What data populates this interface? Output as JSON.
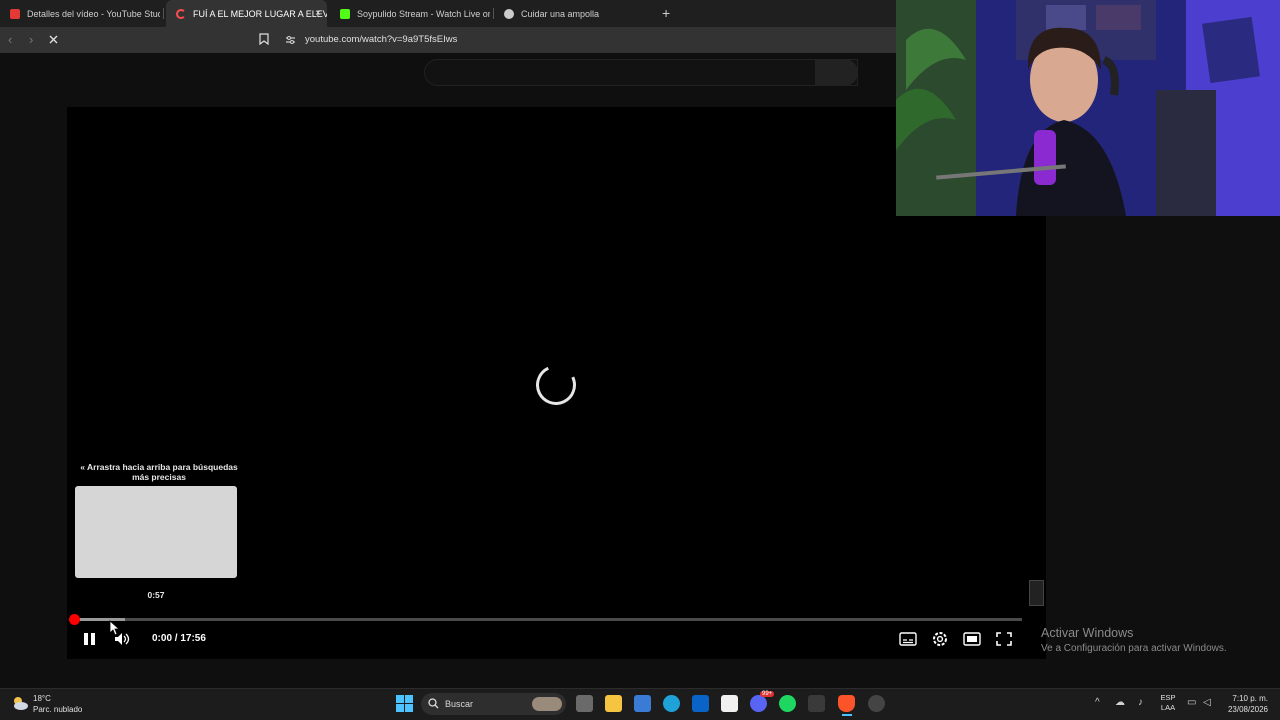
{
  "browser": {
    "tabs": [
      {
        "title": "Detalles del vídeo - YouTube Studio",
        "color": "#e53935"
      },
      {
        "title": "FUÍ A EL MEJOR LUGAR A ELEVA",
        "color": "#ff4d4d"
      },
      {
        "title": "Soypulido Stream - Watch Live on Ki",
        "color": "#53fc18"
      },
      {
        "title": "Cuidar una ampolla",
        "color": "#cccccc"
      }
    ],
    "new_tab": "+",
    "close_tab": "×",
    "address": "youtube.com/watch?v=9a9T5fsEIws"
  },
  "player": {
    "hint": "« Arrastra hacia arriba para búsquedas más precisas",
    "thumb_time": "0:57",
    "time": "0:00 / 17:56",
    "progress_buffered": 0.053
  },
  "watermark": {
    "title": "Activar Windows",
    "subtitle": "Ve a Configuración para activar Windows."
  },
  "taskbar": {
    "temperature": "18°C",
    "condition": "Parc. nublado",
    "search": "Buscar",
    "lang_top": "ESP",
    "lang_bottom": "LAA",
    "time": "7:10 p. m.",
    "date": "23/08/2026",
    "badge": "99+"
  }
}
